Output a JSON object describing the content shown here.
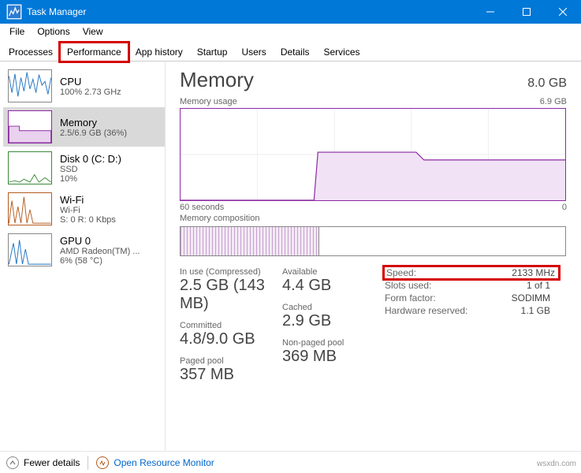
{
  "window": {
    "title": "Task Manager"
  },
  "menu": {
    "file": "File",
    "options": "Options",
    "view": "View"
  },
  "tabs": {
    "processes": "Processes",
    "performance": "Performance",
    "apphistory": "App history",
    "startup": "Startup",
    "users": "Users",
    "details": "Details",
    "services": "Services"
  },
  "sidebar": {
    "cpu": {
      "name": "CPU",
      "sub": "100%  2.73 GHz"
    },
    "memory": {
      "name": "Memory",
      "sub": "2.5/6.9 GB (36%)"
    },
    "disk": {
      "name": "Disk 0 (C: D:)",
      "sub1": "SSD",
      "sub2": "10%"
    },
    "wifi": {
      "name": "Wi-Fi",
      "sub1": "Wi-Fi",
      "sub2": "S: 0 R: 0 Kbps"
    },
    "gpu": {
      "name": "GPU 0",
      "sub1": "AMD Radeon(TM) ...",
      "sub2": "6% (58 °C)"
    }
  },
  "header": {
    "title": "Memory",
    "capacity": "8.0 GB"
  },
  "usage_chart": {
    "label": "Memory usage",
    "max_label": "6.9 GB",
    "x_left": "60 seconds",
    "x_right": "0"
  },
  "composition": {
    "label": "Memory composition"
  },
  "stats": {
    "inuse_label": "In use (Compressed)",
    "inuse": "2.5 GB (143 MB)",
    "available_label": "Available",
    "available": "4.4 GB",
    "committed_label": "Committed",
    "committed": "4.8/9.0 GB",
    "cached_label": "Cached",
    "cached": "2.9 GB",
    "paged_label": "Paged pool",
    "paged": "357 MB",
    "nonpaged_label": "Non-paged pool",
    "nonpaged": "369 MB"
  },
  "details": {
    "speed_k": "Speed:",
    "speed_v": "2133 MHz",
    "slots_k": "Slots used:",
    "slots_v": "1 of 1",
    "form_k": "Form factor:",
    "form_v": "SODIMM",
    "hw_k": "Hardware reserved:",
    "hw_v": "1.1 GB"
  },
  "footer": {
    "fewer": "Fewer details",
    "orm": "Open Resource Monitor"
  },
  "watermark": "wsxdn.com",
  "chart_data": {
    "type": "area",
    "title": "Memory usage",
    "ylabel": "Memory usage",
    "ylim": [
      0,
      6.9
    ],
    "y_unit": "GB",
    "xlabel": "seconds",
    "xlim": [
      60,
      0
    ],
    "series": [
      {
        "name": "Memory usage (GB)",
        "x": [
          60,
          40,
          39,
          26,
          25,
          0
        ],
        "values": [
          0,
          0,
          3.6,
          3.6,
          3.1,
          3.1
        ]
      }
    ]
  }
}
